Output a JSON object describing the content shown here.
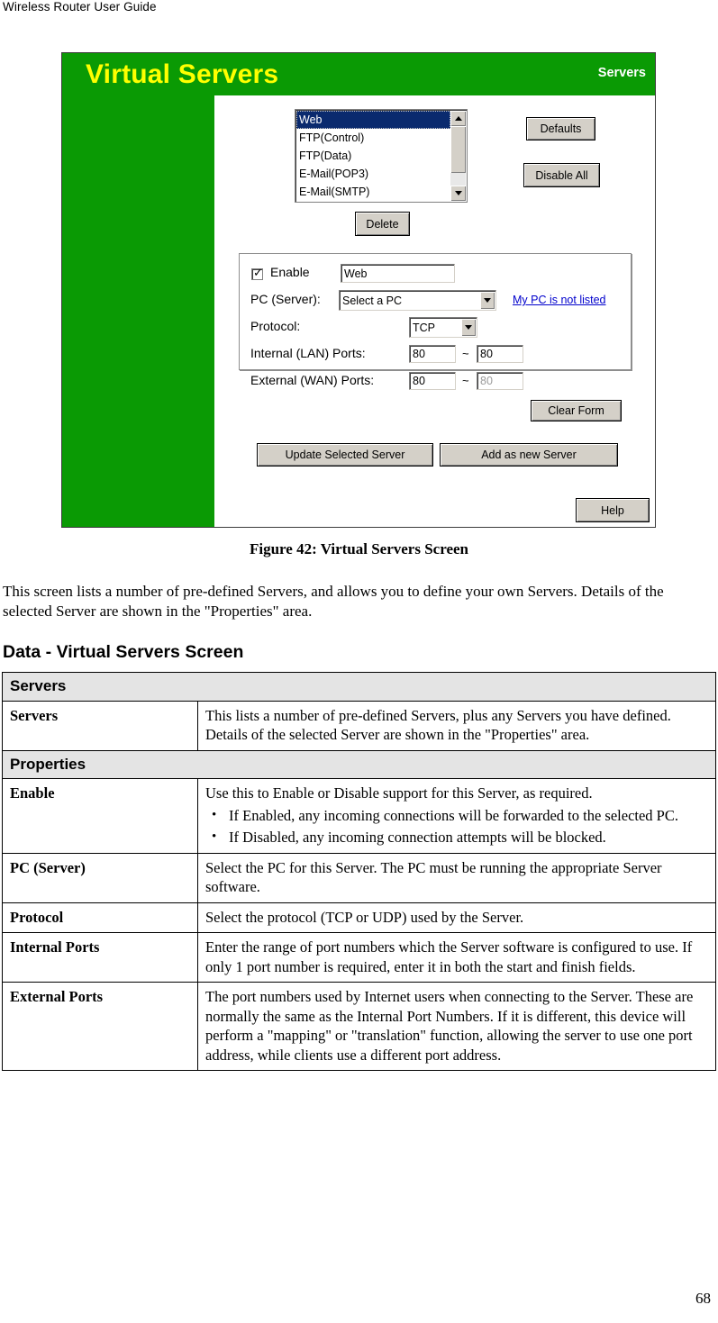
{
  "document": {
    "running_head": "Wireless Router User Guide",
    "page_number": "68",
    "figure_caption": "Figure 42: Virtual Servers Screen",
    "intro_paragraph": "This screen lists a number of pre-defined Servers, and allows you to define your own Servers. Details of the selected Server are shown in the \"Properties\" area.",
    "section_heading": "Data - Virtual Servers Screen"
  },
  "screenshot": {
    "title": "Virtual Servers",
    "accent_green": "#0a9a04",
    "title_text_color": "#ffff00",
    "sidebar": {
      "servers_label": "Servers",
      "properties_label": "Properties"
    },
    "servers_list": {
      "options": [
        "Web",
        "FTP(Control)",
        "FTP(Data)",
        "E-Mail(POP3)",
        "E-Mail(SMTP)"
      ],
      "selected": "Web"
    },
    "buttons": {
      "defaults": "Defaults",
      "disable_all": "Disable All",
      "delete": "Delete",
      "clear_form": "Clear Form",
      "update_selected_server": "Update Selected Server",
      "add_as_new_server": "Add as new Server",
      "help": "Help"
    },
    "properties": {
      "enable_label": "Enable",
      "enable_checked": true,
      "name_value": "Web",
      "pc_server_label": "PC (Server):",
      "pc_server_value": "Select a PC",
      "pc_not_listed_link": "My PC is not listed",
      "protocol_label": "Protocol:",
      "protocol_value": "TCP",
      "internal_ports_label": "Internal (LAN) Ports:",
      "internal_port_start": "80",
      "internal_port_end": "80",
      "external_ports_label": "External (WAN) Ports:",
      "external_port_start": "80",
      "external_port_end": "80",
      "range_separator": "~"
    }
  },
  "table": {
    "groups": [
      {
        "header": "Servers",
        "rows": [
          {
            "key": "Servers",
            "text": "This lists a number of pre-defined Servers, plus any Servers you have defined. Details of the selected Server are shown in the \"Properties\" area.",
            "bullets": []
          }
        ]
      },
      {
        "header": "Properties",
        "rows": [
          {
            "key": "Enable",
            "text": "Use this to Enable or Disable support for this Server, as required.",
            "bullets": [
              "If Enabled, any incoming connections will be forwarded to the selected PC.",
              "If Disabled, any incoming connection attempts will be blocked."
            ]
          },
          {
            "key": "PC (Server)",
            "text": "Select the PC for this Server. The PC must be running the appropriate Server software.",
            "bullets": []
          },
          {
            "key": "Protocol",
            "text": "Select the protocol (TCP or UDP) used by the Server.",
            "bullets": []
          },
          {
            "key": "Internal Ports",
            "text": "Enter the range of port numbers which the Server software is configured to use. If only 1 port number is required, enter it in both the start and finish fields.",
            "bullets": []
          },
          {
            "key": "External Ports",
            "text": "The port numbers used by Internet users when connecting to the Server. These are normally the same as the Internal Port Numbers. If it is different, this device will perform a \"mapping\" or \"translation\" function, allowing the server to use one port address, while clients use a different port address.",
            "bullets": []
          }
        ]
      }
    ]
  }
}
